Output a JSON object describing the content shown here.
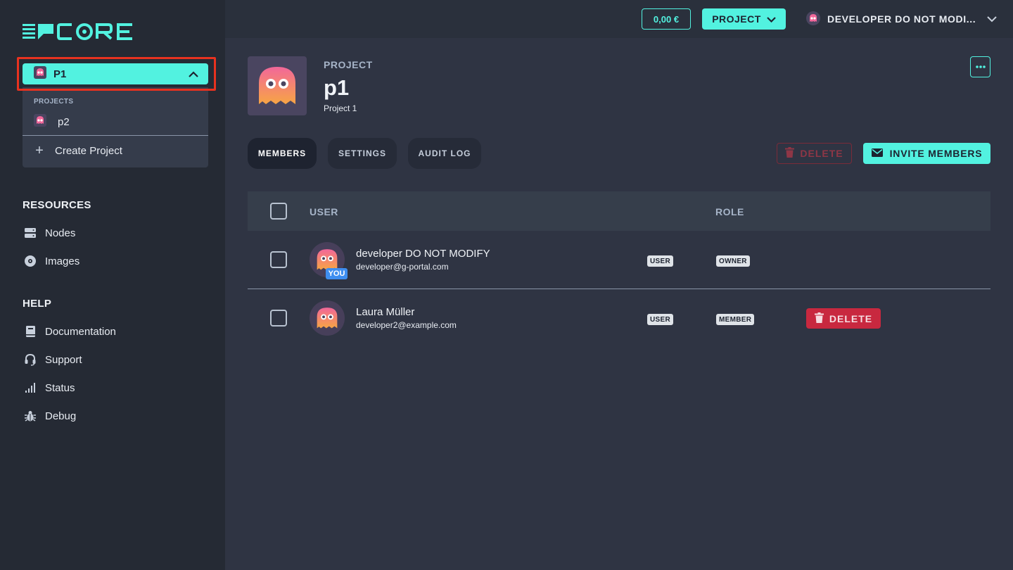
{
  "brand": {
    "logo_text": "C RE",
    "logo_icon": "g-portal-logo-icon"
  },
  "sidebar": {
    "project_selector": {
      "label": "P1",
      "icon": "ghost-icon"
    },
    "dropdown": {
      "heading": "PROJECTS",
      "items": [
        {
          "label": "p2",
          "icon": "ghost-icon"
        }
      ],
      "create_label": "Create Project"
    },
    "sections": [
      {
        "heading": "RESOURCES",
        "items": [
          {
            "label": "Nodes",
            "icon": "server-icon"
          },
          {
            "label": "Images",
            "icon": "disc-icon"
          }
        ]
      },
      {
        "heading": "HELP",
        "items": [
          {
            "label": "Documentation",
            "icon": "book-icon"
          },
          {
            "label": "Support",
            "icon": "headset-icon"
          },
          {
            "label": "Status",
            "icon": "signal-bars-icon"
          },
          {
            "label": "Debug",
            "icon": "bug-icon"
          }
        ]
      }
    ]
  },
  "topbar": {
    "balance": "0,00 €",
    "project_button": "PROJECT",
    "user_name": "DEVELOPER DO NOT MODI..."
  },
  "project": {
    "label": "PROJECT",
    "name": "p1",
    "description": "Project 1"
  },
  "tabs": [
    {
      "label": "MEMBERS",
      "active": true
    },
    {
      "label": "SETTINGS",
      "active": false
    },
    {
      "label": "AUDIT LOG",
      "active": false
    }
  ],
  "actions": {
    "delete_label": "DELETE",
    "invite_label": "INVITE MEMBERS"
  },
  "table": {
    "columns": [
      "USER",
      "ROLE"
    ],
    "rows": [
      {
        "name": "developer DO NOT MODIFY",
        "email": "developer@g-portal.com",
        "badge": "YOU",
        "type": "USER",
        "role": "OWNER",
        "action": ""
      },
      {
        "name": "Laura Müller",
        "email": "developer2@example.com",
        "badge": "",
        "type": "USER",
        "role": "MEMBER",
        "action": "DELETE"
      }
    ]
  },
  "colors": {
    "accent": "#52f2e0",
    "danger": "#c8283f",
    "background": "#2f3443",
    "sidebar": "#252a34"
  }
}
